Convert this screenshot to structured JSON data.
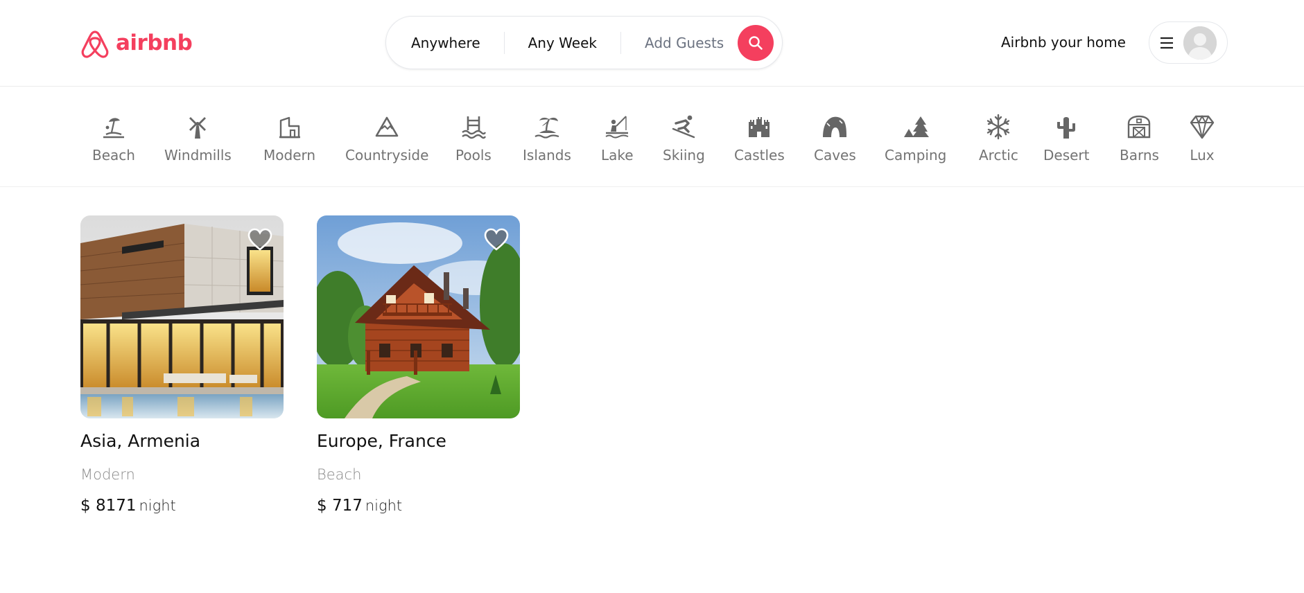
{
  "header": {
    "logo_text": "airbnb",
    "brand_color": "#f43f5e",
    "search": {
      "location": "Anywhere",
      "dates": "Any Week",
      "guests": "Add Guests"
    },
    "host_link": "Airbnb your home"
  },
  "categories": [
    {
      "label": "Beach",
      "icon": "beach-icon"
    },
    {
      "label": "Windmills",
      "icon": "windmill-icon"
    },
    {
      "label": "Modern",
      "icon": "modern-house-icon"
    },
    {
      "label": "Countryside",
      "icon": "mountain-icon"
    },
    {
      "label": "Pools",
      "icon": "pool-icon"
    },
    {
      "label": "Islands",
      "icon": "island-icon"
    },
    {
      "label": "Lake",
      "icon": "lake-icon"
    },
    {
      "label": "Skiing",
      "icon": "skiing-icon"
    },
    {
      "label": "Castles",
      "icon": "castle-icon"
    },
    {
      "label": "Caves",
      "icon": "cave-icon"
    },
    {
      "label": "Camping",
      "icon": "camping-icon"
    },
    {
      "label": "Arctic",
      "icon": "snowflake-icon"
    },
    {
      "label": "Desert",
      "icon": "cactus-icon"
    },
    {
      "label": "Barns",
      "icon": "barn-icon"
    },
    {
      "label": "Lux",
      "icon": "diamond-icon"
    }
  ],
  "listings": [
    {
      "location": "Asia, Armenia",
      "category": "Modern",
      "price": "$ 8171",
      "unit": "night"
    },
    {
      "location": "Europe, France",
      "category": "Beach",
      "price": "$ 717",
      "unit": "night"
    }
  ]
}
